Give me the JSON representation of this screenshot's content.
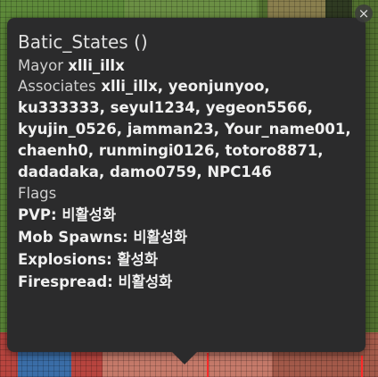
{
  "popup": {
    "title": "Batic_States ()",
    "mayor_label": "Mayor",
    "mayor_value": "xlli_illx",
    "associates_label": "Associates",
    "associates_value": "xlli_illx, yeonjunyoo, ku333333, seyul1234, yegeon5566, kyujin_0526, jamman23, Your_name001, chaenh0, runmingi0126, totoro8871, dadadaka, damo0759, NPC146",
    "flags_label": "Flags",
    "flags": [
      {
        "name": "PVP:",
        "value": "비활성화"
      },
      {
        "name": "Mob Spawns:",
        "value": "비활성화"
      },
      {
        "name": "Explosions:",
        "value": "활성화"
      },
      {
        "name": "Firespread:",
        "value": "비활성화"
      }
    ]
  },
  "close_label": "×"
}
